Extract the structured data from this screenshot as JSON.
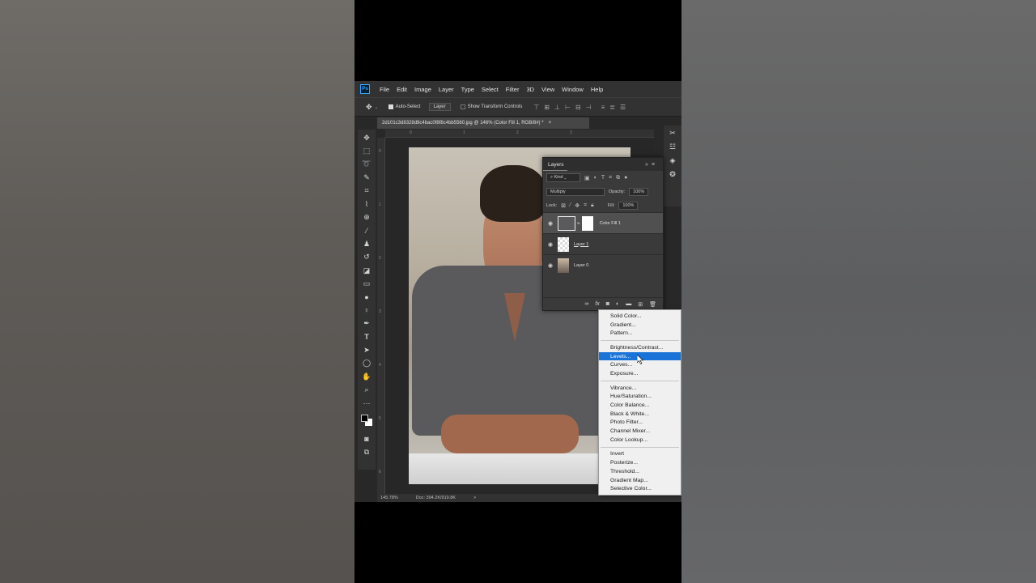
{
  "app": {
    "logo": "Ps",
    "menu": [
      "File",
      "Edit",
      "Image",
      "Layer",
      "Type",
      "Select",
      "Filter",
      "3D",
      "View",
      "Window",
      "Help"
    ]
  },
  "options": {
    "auto_select_label": "Auto-Select",
    "target_value": "Layer",
    "show_transform_label": "Show Transform Controls"
  },
  "document": {
    "tab_title": "2d101c3d8328d9c4bac0f8f8c4bb5560.jpg @ 146% (Color Fill 1, RGB/8#) *",
    "close_glyph": "×",
    "ruler_marks": [
      "0",
      "1",
      "2",
      "3"
    ],
    "ruler_marks_v": [
      "0",
      "1",
      "2",
      "3",
      "4",
      "5",
      "6"
    ]
  },
  "status": {
    "zoom": "145.78%",
    "doc": "Doc: 394.2K/919.8K",
    "arrow": ">"
  },
  "layers": {
    "title": "Layers",
    "kind_value": "Kind",
    "blend_mode": "Multiply",
    "opacity_label": "Opacity:",
    "opacity_value": "100%",
    "lock_label": "Lock:",
    "fill_label": "Fill:",
    "fill_value": "100%",
    "items": [
      {
        "name": "Color Fill 1"
      },
      {
        "name": "Layer 1"
      },
      {
        "name": "Layer 0"
      }
    ]
  },
  "adjust_menu": {
    "group1": [
      "Solid Color...",
      "Gradient...",
      "Pattern..."
    ],
    "group2": [
      "Brightness/Contrast...",
      "Levels...",
      "Curves...",
      "Exposure..."
    ],
    "group3": [
      "Vibrance...",
      "Hue/Saturation...",
      "Color Balance...",
      "Black & White...",
      "Photo Filter...",
      "Channel Mixer...",
      "Color Lookup..."
    ],
    "group4": [
      "Invert",
      "Posterize...",
      "Threshold...",
      "Gradient Map...",
      "Selective Color..."
    ],
    "highlighted": "Levels..."
  },
  "colors": {
    "highlight": "#1a73d6",
    "ui_dark": "#282828",
    "panel": "#3a3a3a"
  }
}
